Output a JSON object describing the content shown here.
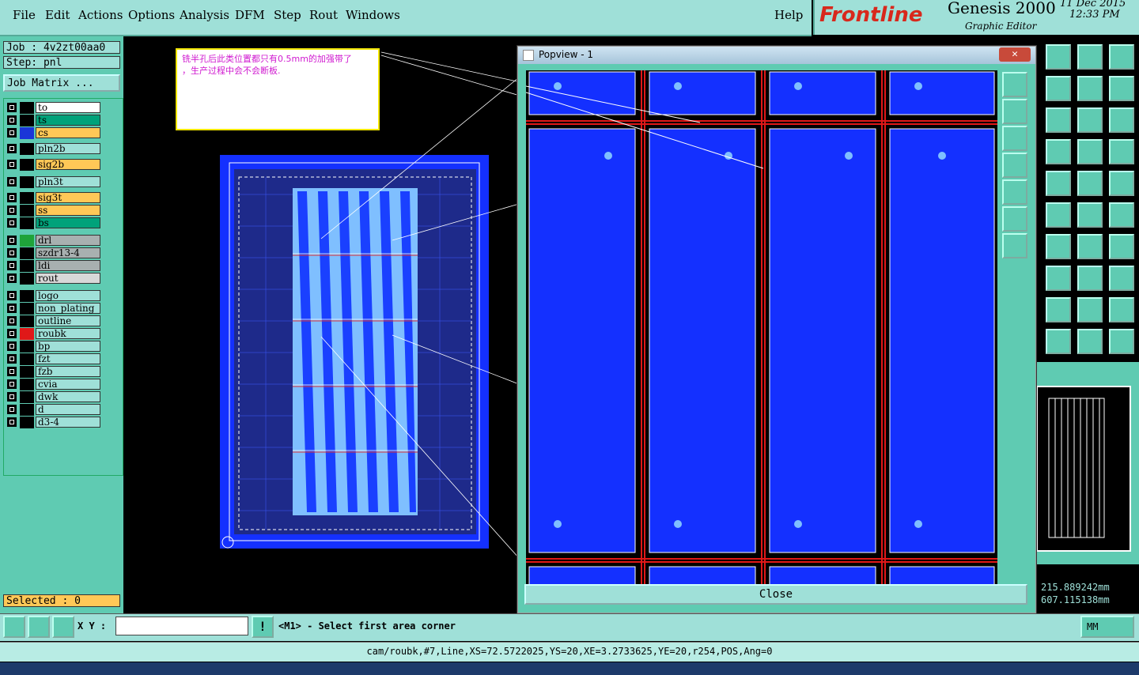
{
  "menu": {
    "file": "File",
    "edit": "Edit",
    "actions": "Actions",
    "options": "Options",
    "analysis": "Analysis",
    "dfm": "DFM",
    "step": "Step",
    "rout": "Rout",
    "windows": "Windows",
    "help": "Help"
  },
  "brand": {
    "logo": "Frontline",
    "product": "Genesis 2000",
    "subtitle": "Graphic Editor",
    "date": "11 Dec 2015",
    "time": "12:33 PM"
  },
  "left": {
    "job": "Job : 4v2zt00aa0",
    "step": "Step: pnl",
    "job_matrix": "Job Matrix ...",
    "selected": "Selected : 0",
    "layers": [
      {
        "name": "to",
        "color": "#ffffff"
      },
      {
        "name": "ts",
        "color": "#00a27a"
      },
      {
        "name": "cs",
        "color": "#ffc857",
        "swatch": "#1a35d8"
      },
      {
        "name": "pln2b",
        "color": "#9fe0d8"
      },
      {
        "name": "sig2b",
        "color": "#ffc857"
      },
      {
        "name": "pln3t",
        "color": "#9fe0d8"
      },
      {
        "name": "sig3t",
        "color": "#ffc857"
      },
      {
        "name": "ss",
        "color": "#ffc857"
      },
      {
        "name": "bs",
        "color": "#00a27a"
      },
      {
        "name": "drl",
        "color": "#a8b0b0",
        "swatch": "#1fa33a"
      },
      {
        "name": "szdr13-4",
        "color": "#a8b0b0"
      },
      {
        "name": "ldi",
        "color": "#a8b0b0"
      },
      {
        "name": "rout",
        "color": "#d8d8d8"
      },
      {
        "name": "logo",
        "color": "#9fe0d8"
      },
      {
        "name": "non_plating",
        "color": "#9fe0d8"
      },
      {
        "name": "outline",
        "color": "#9fe0d8"
      },
      {
        "name": "roubk",
        "color": "#9fe0d8",
        "swatch": "#e01818"
      },
      {
        "name": "bp",
        "color": "#9fe0d8"
      },
      {
        "name": "fzt",
        "color": "#9fe0d8"
      },
      {
        "name": "fzb",
        "color": "#9fe0d8"
      },
      {
        "name": "cvia",
        "color": "#9fe0d8"
      },
      {
        "name": "dwk",
        "color": "#9fe0d8"
      },
      {
        "name": "d",
        "color": "#9fe0d8"
      },
      {
        "name": "d3-4",
        "color": "#9fe0d8"
      }
    ]
  },
  "note": {
    "line1": "铣半孔后此类位置都只有0.5mm的加强带了",
    "line2": "，生产过程中会不会断板."
  },
  "popview": {
    "title": "Popview - 1",
    "close": "Close"
  },
  "coords": {
    "x": "215.889242mm",
    "y": "607.115138mm"
  },
  "command": {
    "xy_label": "X Y :",
    "xy_value": "",
    "prompt": "<M1> - Select first area corner",
    "units": "MM"
  },
  "status": {
    "text": "cam/roubk,#7,Line,XS=72.5722025,YS=20,XE=3.2733625,YE=20,r254,POS,Ang=0"
  }
}
